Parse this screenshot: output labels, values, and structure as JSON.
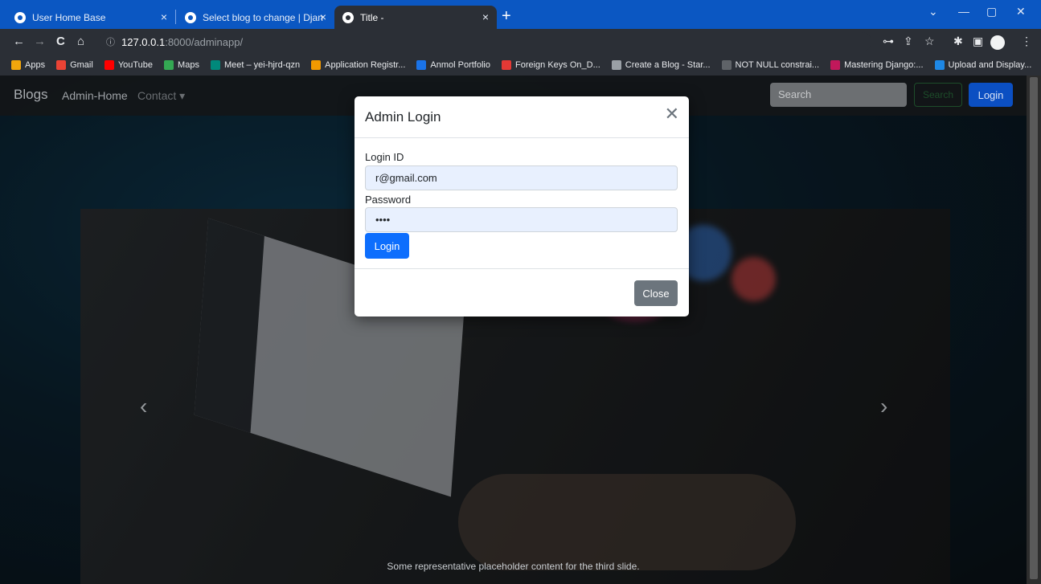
{
  "browser": {
    "tabs": [
      {
        "title": "User Home Base",
        "close": "×"
      },
      {
        "title": "Select blog to change | Django si",
        "close": "×"
      },
      {
        "title": "Title -",
        "close": "×"
      }
    ],
    "new_tab": "+",
    "window_controls": {
      "dropdown": "⌄",
      "minimize": "—",
      "maximize": "▢",
      "close": "✕"
    },
    "nav": {
      "back": "←",
      "forward": "→",
      "reload": "C",
      "home": "⌂"
    },
    "url": {
      "info_icon": "ⓘ",
      "host": "127.0.0.1",
      "rest": ":8000/adminapp/"
    },
    "toolbar_icons": {
      "key": "⊶",
      "share": "⇪",
      "star": "☆",
      "extensions": "✱",
      "sidebar": "▣",
      "menu": "⋮"
    },
    "bookmarks": [
      {
        "label": "Apps",
        "color": "#f2a60c"
      },
      {
        "label": "Gmail",
        "color": "#ea4335"
      },
      {
        "label": "YouTube",
        "color": "#ff0000"
      },
      {
        "label": "Maps",
        "color": "#34a853"
      },
      {
        "label": "Meet – yei-hjrd-qzn",
        "color": "#00897b"
      },
      {
        "label": "Application Registr...",
        "color": "#f29900"
      },
      {
        "label": "Anmol Portfolio",
        "color": "#1a73e8"
      },
      {
        "label": "Foreign Keys On_D...",
        "color": "#e53935"
      },
      {
        "label": "Create a Blog - Star...",
        "color": "#9aa0a6"
      },
      {
        "label": "NOT NULL constrai...",
        "color": "#5f6368"
      },
      {
        "label": "Mastering Django:...",
        "color": "#c2185b"
      },
      {
        "label": "Upload and Display...",
        "color": "#1e88e5"
      }
    ]
  },
  "navbar": {
    "brand": "Blogs",
    "links": [
      {
        "label": "Admin-Home"
      },
      {
        "label": "Contact ▾"
      }
    ],
    "search_placeholder": "Search",
    "search_button": "Search",
    "login_button": "Login"
  },
  "modal": {
    "title": "Admin Login",
    "close_icon": "✕",
    "login_id_label": "Login ID",
    "login_id_value": "r@gmail.com",
    "password_label": "Password",
    "password_value": "••••",
    "login_button": "Login",
    "close_button": "Close"
  },
  "carousel": {
    "prev": "‹",
    "next": "›",
    "caption": "Some representative placeholder content for the third slide."
  }
}
